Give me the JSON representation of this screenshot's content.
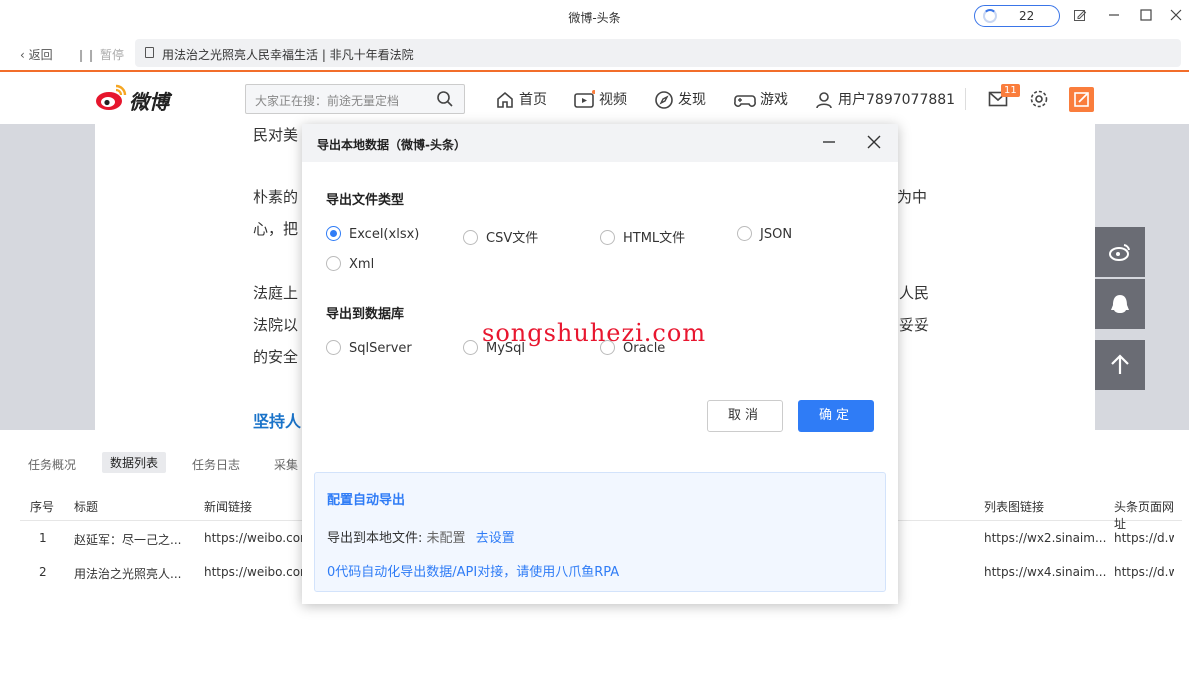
{
  "window": {
    "title": "微博-头条",
    "task_count": "22"
  },
  "nav": {
    "back_label": "返回",
    "pause_label": "暂停",
    "url_title": "用法治之光照亮人民幸福生活 | 非凡十年看法院"
  },
  "weibo": {
    "logo_text": "微博",
    "search_placeholder": "大家正在搜：前途无量定档",
    "items": [
      {
        "label": "首页"
      },
      {
        "label": "视频"
      },
      {
        "label": "发现"
      },
      {
        "label": "游戏"
      },
      {
        "label": "用户7897077881"
      }
    ],
    "message_badge": "11"
  },
  "article": {
    "lines": [
      "民对美",
      "朴素的",
      "为中",
      "心，把",
      "法庭上",
      "人民",
      "法院以",
      "妥妥",
      "的安全"
    ],
    "heading": "坚持人"
  },
  "bottom": {
    "tabs": [
      "任务概况",
      "数据列表",
      "任务日志",
      "采集"
    ],
    "columns": [
      "序号",
      "标题",
      "新闻链接",
      "列表图链接",
      "头条页面网址"
    ],
    "rows": [
      {
        "no": "1",
        "title": "赵延军：尽一己之...",
        "link": "https://weibo.com",
        "img": "https://wx2.sinaim...",
        "page": "https://d.w"
      },
      {
        "no": "2",
        "title": "用法治之光照亮人...",
        "link": "https://weibo.com",
        "img": "https://wx4.sinaim...",
        "page": "https://d.w"
      }
    ]
  },
  "dialog": {
    "title": "导出本地数据（微博-头条）",
    "file_type_label": "导出文件类型",
    "file_types": [
      {
        "label": "Excel(xlsx)",
        "checked": true
      },
      {
        "label": "CSV文件",
        "checked": false
      },
      {
        "label": "HTML文件",
        "checked": false
      },
      {
        "label": "JSON",
        "checked": false
      },
      {
        "label": "Xml",
        "checked": false
      }
    ],
    "db_label": "导出到数据库",
    "databases": [
      {
        "label": "SqlServer"
      },
      {
        "label": "MySql"
      },
      {
        "label": "Oracle"
      }
    ],
    "watermark": "songshuhezi.com",
    "cancel_label": "取消",
    "ok_label": "确定",
    "auto": {
      "title": "配置自动导出",
      "file_label": "导出到本地文件:",
      "file_status": "未配置",
      "file_link": "去设置",
      "rpa_link": "0代码自动化导出数据/API对接，请使用八爪鱼RPA"
    }
  }
}
